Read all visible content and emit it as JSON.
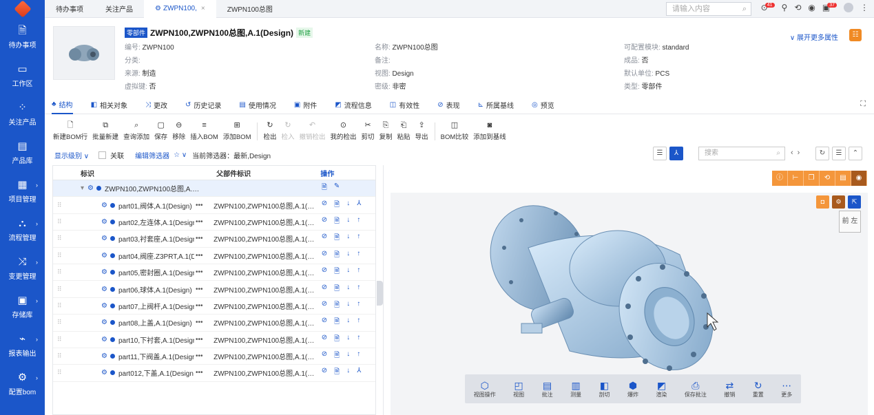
{
  "sidebar": {
    "items": [
      {
        "label": "待办事项",
        "icon": "document-icon",
        "glyph": "🗎"
      },
      {
        "label": "工作区",
        "icon": "monitor-icon",
        "glyph": "▭"
      },
      {
        "label": "关注产品",
        "icon": "grid-icon",
        "glyph": "⁘"
      },
      {
        "label": "产品库",
        "icon": "book-icon",
        "glyph": "▤"
      },
      {
        "label": "项目管理",
        "icon": "project-icon",
        "glyph": "▦"
      },
      {
        "label": "流程管理",
        "icon": "flow-icon",
        "glyph": "⛬"
      },
      {
        "label": "变更管理",
        "icon": "change-icon",
        "glyph": "⤨"
      },
      {
        "label": "存储库",
        "icon": "storage-icon",
        "glyph": "▣"
      },
      {
        "label": "报表输出",
        "icon": "report-icon",
        "glyph": "⌁"
      },
      {
        "label": "配置bom",
        "icon": "gear-icon",
        "glyph": "⚙"
      }
    ]
  },
  "topbar": {
    "tabs": [
      {
        "label": "待办事项",
        "active": false
      },
      {
        "label": "关注产品",
        "active": false
      },
      {
        "label": "ZWPN100,",
        "active": true
      },
      {
        "label": "ZWPN100总图",
        "active": false
      }
    ],
    "search_placeholder": "请输入内容",
    "notif_count_1": "41",
    "notif_count_2": "37"
  },
  "header": {
    "type_tag": "零部件",
    "title": "ZWPN100,ZWPN100总图,A.1(Design)",
    "status_tag": "新建",
    "expand_label": "展开更多属性",
    "attrs_col1": [
      {
        "k": "编号:",
        "v": " ZWPN100"
      },
      {
        "k": "分类:",
        "v": ""
      },
      {
        "k": "来源:",
        "v": " 制造"
      },
      {
        "k": "虚拟键:",
        "v": " 否"
      }
    ],
    "attrs_col2": [
      {
        "k": "名称:",
        "v": " ZWPN100总图"
      },
      {
        "k": "备注:",
        "v": ""
      },
      {
        "k": "视图:",
        "v": " Design"
      },
      {
        "k": "密级:",
        "v": " 非密"
      }
    ],
    "attrs_col3": [
      {
        "k": "可配置模块:",
        "v": " standard"
      },
      {
        "k": "成品:",
        "v": " 否"
      },
      {
        "k": "默认单位:",
        "v": " PCS"
      },
      {
        "k": "类型:",
        "v": " 零部件"
      }
    ]
  },
  "navtabs": [
    {
      "label": "结构",
      "icon": "structure-icon",
      "glyph": "♣",
      "active": true
    },
    {
      "label": "相关对象",
      "icon": "related-icon",
      "glyph": "◧",
      "active": false
    },
    {
      "label": "更改",
      "icon": "change-icon",
      "glyph": "⤨",
      "active": false
    },
    {
      "label": "历史记录",
      "icon": "history-icon",
      "glyph": "↺",
      "active": false
    },
    {
      "label": "使用情况",
      "icon": "usage-icon",
      "glyph": "▤",
      "active": false
    },
    {
      "label": "附件",
      "icon": "attachment-icon",
      "glyph": "▣",
      "active": false
    },
    {
      "label": "流程信息",
      "icon": "process-icon",
      "glyph": "◩",
      "active": false
    },
    {
      "label": "有效性",
      "icon": "validity-icon",
      "glyph": "◫",
      "active": false
    },
    {
      "label": "表现",
      "icon": "presentation-icon",
      "glyph": "⊘",
      "active": false
    },
    {
      "label": "所属基线",
      "icon": "baseline-icon",
      "glyph": "⊾",
      "active": false
    },
    {
      "label": "预览",
      "icon": "preview-icon",
      "glyph": "◎",
      "active": false
    }
  ],
  "toolbar": {
    "groups": [
      [
        {
          "label": "新建BOM行",
          "glyph": "🗋",
          "enabled": true
        },
        {
          "label": "批量新建",
          "glyph": "⧉",
          "enabled": true
        },
        {
          "label": "查询添加",
          "glyph": "⌕",
          "enabled": true
        },
        {
          "label": "保存",
          "glyph": "▢",
          "enabled": true
        },
        {
          "label": "移除",
          "glyph": "⊖",
          "enabled": true
        },
        {
          "label": "插入BOM",
          "glyph": "≡",
          "enabled": true
        },
        {
          "label": "添加BOM",
          "glyph": "⊞",
          "enabled": true
        }
      ],
      [
        {
          "label": "检出",
          "glyph": "↻",
          "enabled": true
        },
        {
          "label": "检入",
          "glyph": "↻",
          "enabled": false
        },
        {
          "label": "撤销检出",
          "glyph": "↶",
          "enabled": false
        },
        {
          "label": "我的检出",
          "glyph": "⊙",
          "enabled": true
        },
        {
          "label": "剪切",
          "glyph": "✂",
          "enabled": true
        },
        {
          "label": "复制",
          "glyph": "⎘",
          "enabled": true
        },
        {
          "label": "粘贴",
          "glyph": "⎗",
          "enabled": true
        },
        {
          "label": "导出",
          "glyph": "⇪",
          "enabled": true
        }
      ],
      [
        {
          "label": "BOM比较",
          "glyph": "◫",
          "enabled": true
        },
        {
          "label": "添加到基线",
          "glyph": "◙",
          "enabled": true
        }
      ]
    ]
  },
  "filter": {
    "level_label": "显示级别",
    "link_label": "关联",
    "edit_filter_label": "编辑筛选器",
    "current_filter": "当前筛选器：最新,Design",
    "search_placeholder": "搜索"
  },
  "table": {
    "headers": [
      "标识",
      "父部件标识",
      "操作"
    ],
    "root": {
      "id": "ZWPN100,ZWPN100总图,A.…"
    },
    "rows": [
      {
        "id": "part01,阀体,A.1(Design)",
        "parent": "ZWPN100,ZWPN100总图,A.1(…",
        "last": "⅄"
      },
      {
        "id": "part02,左连体,A.1(Desigr",
        "parent": "ZWPN100,ZWPN100总图,A.1(…",
        "last": "↑"
      },
      {
        "id": "part03,衬套座,A.1(Desigr",
        "parent": "ZWPN100,ZWPN100总图,A.1(…",
        "last": "↑"
      },
      {
        "id": "part04,阀座.Z3PRT,A.1(D",
        "parent": "ZWPN100,ZWPN100总图,A.1(…",
        "last": "↑"
      },
      {
        "id": "part05,密封圈,A.1(Desigr",
        "parent": "ZWPN100,ZWPN100总图,A.1(…",
        "last": "↑"
      },
      {
        "id": "part06,球体,A.1(Design)",
        "parent": "ZWPN100,ZWPN100总图,A.1(…",
        "last": "↑"
      },
      {
        "id": "part07,上阀杆,A.1(Desigr",
        "parent": "ZWPN100,ZWPN100总图,A.1(…",
        "last": "↑"
      },
      {
        "id": "part08,上盖,A.1(Design)",
        "parent": "ZWPN100,ZWPN100总图,A.1(…",
        "last": "↑"
      },
      {
        "id": "part10,下衬套,A.1(Desigr",
        "parent": "ZWPN100,ZWPN100总图,A.1(…",
        "last": "↑"
      },
      {
        "id": "part11,下阀盖,A.1(Desigr",
        "parent": "ZWPN100,ZWPN100总图,A.1(…",
        "last": "↑"
      },
      {
        "id": "part012,下盖,A.1(Design",
        "parent": "ZWPN100,ZWPN100总图,A.1(…",
        "last": "⅄"
      }
    ]
  },
  "viewer": {
    "cube_label": "前 左",
    "bottom_tools": [
      {
        "label": "视图操作",
        "glyph": "⬡"
      },
      {
        "label": "视图",
        "glyph": "◰"
      },
      {
        "label": "批注",
        "glyph": "▤"
      },
      {
        "label": "测量",
        "glyph": "▥"
      },
      {
        "label": "剖切",
        "glyph": "◧"
      },
      {
        "label": "爆炸",
        "glyph": "⬢"
      },
      {
        "label": "渲染",
        "glyph": "◩"
      },
      {
        "label": "保存批注",
        "glyph": "⎙"
      },
      {
        "label": "撤销",
        "glyph": "⇄"
      },
      {
        "label": "重置",
        "glyph": "↻"
      },
      {
        "label": "更多",
        "glyph": "⋯"
      }
    ]
  },
  "colors": {
    "accent": "#1b56c9",
    "orange": "#f4963b",
    "tag_green": "#22a045"
  }
}
